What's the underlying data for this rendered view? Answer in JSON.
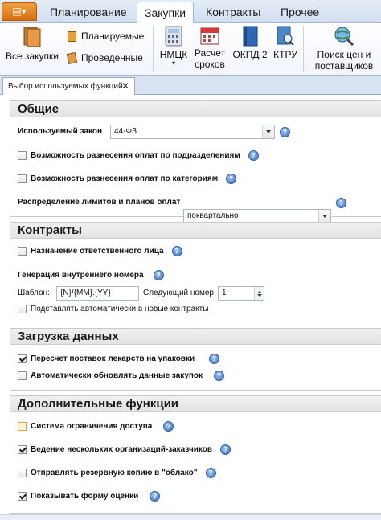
{
  "menu_tabs": [
    "Планирование",
    "Закупки",
    "Контракты",
    "Прочее"
  ],
  "ribbon": {
    "all_purchases": "Все закупки",
    "planned": "Планируемые",
    "conducted": "Проведенные",
    "nmck": "НМЦК",
    "calc_terms_1": "Расчет",
    "calc_terms_2": "сроков",
    "okpd": "ОКПД 2",
    "ktru": "КТРУ",
    "price_search_1": "Поиск цен и",
    "price_search_2": "поставщиков"
  },
  "doc_tab": {
    "title": "Выбор используемых функций",
    "close": "✕"
  },
  "general": {
    "title": "Общие",
    "law_label": "Используемый закон",
    "law_value": "44-ФЗ",
    "opt_by_divisions": "Возможность разнесения оплат по подразделениям",
    "opt_by_categories": "Возможность разнесения оплат по категориям",
    "limits_label": "Распределение лимитов и планов оплат",
    "limits_value": "поквартально"
  },
  "contracts": {
    "title": "Контракты",
    "responsible": "Назначение ответственного лица",
    "numbering_title": "Генерация внутреннего номера",
    "template_label": "Шаблон:",
    "template_value": "{N}/{MM}.{YY}",
    "next_label": "Следующий номер:",
    "next_value": "1",
    "auto_substitute": "Подставлять автоматически в новые контракты"
  },
  "loading": {
    "title": "Загрузка данных",
    "recalc": "Пересчет поставок лекарств на упаковки",
    "auto_update": "Автоматически обновлять данные закупок"
  },
  "extra": {
    "title": "Дополнительные функции",
    "access": "Система ограничения доступа",
    "multi_org": "Ведение нескольких организаций-заказчиков",
    "backup": "Отправлять резервную копию в \"облако\"",
    "rating": "Показывать форму оценки"
  },
  "help_glyph": "?",
  "colors": {
    "accent": "#3c72c2",
    "app_button": "#e07b1a",
    "ribbon_bg": "#dce7f5"
  }
}
